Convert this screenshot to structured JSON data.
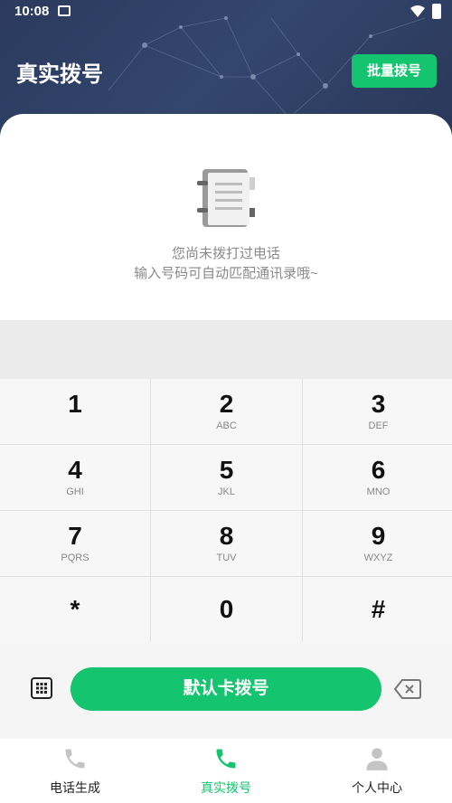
{
  "status_bar": {
    "time": "10:08"
  },
  "header": {
    "title": "真实拨号",
    "batch_button": "批量拨号"
  },
  "empty_state": {
    "line1": "您尚未拨打过电话",
    "line2": "输入号码可自动匹配通讯录哦~"
  },
  "keypad": [
    {
      "digit": "1",
      "letters": ""
    },
    {
      "digit": "2",
      "letters": "ABC"
    },
    {
      "digit": "3",
      "letters": "DEF"
    },
    {
      "digit": "4",
      "letters": "GHI"
    },
    {
      "digit": "5",
      "letters": "JKL"
    },
    {
      "digit": "6",
      "letters": "MNO"
    },
    {
      "digit": "7",
      "letters": "PQRS"
    },
    {
      "digit": "8",
      "letters": "TUV"
    },
    {
      "digit": "9",
      "letters": "WXYZ"
    },
    {
      "digit": "*",
      "letters": ""
    },
    {
      "digit": "0",
      "letters": ""
    },
    {
      "digit": "#",
      "letters": ""
    }
  ],
  "call_bar": {
    "call_button": "默认卡拨号"
  },
  "tabs": [
    {
      "label": "电话生成",
      "icon": "phone-icon"
    },
    {
      "label": "真实拨号",
      "icon": "phone-icon"
    },
    {
      "label": "个人中心",
      "icon": "person-icon"
    }
  ],
  "colors": {
    "accent": "#14c46e",
    "header": "#2f4066"
  }
}
